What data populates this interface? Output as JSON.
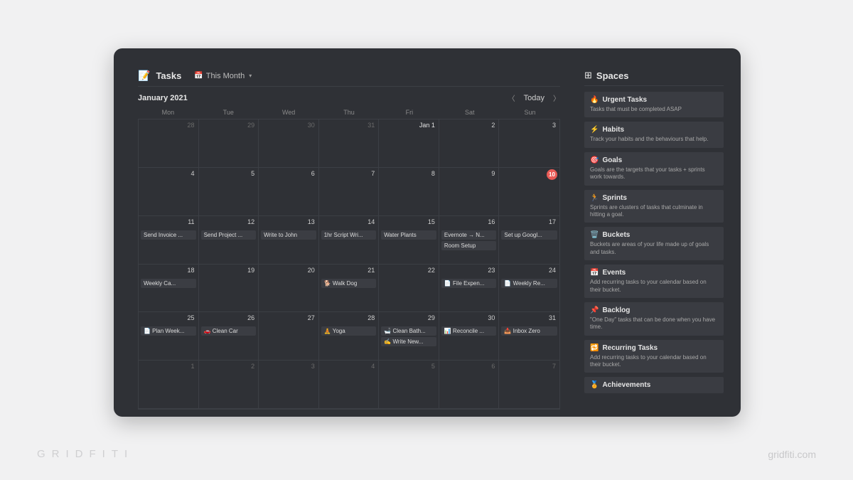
{
  "watermark": {
    "left": "GRIDFITI",
    "right": "gridfiti.com"
  },
  "header": {
    "tasks_icon": "📝",
    "tasks_title": "Tasks",
    "view_icon": "📅",
    "view_label": "This Month"
  },
  "month": {
    "title": "January 2021",
    "today_label": "Today",
    "weekdays": [
      "Mon",
      "Tue",
      "Wed",
      "Thu",
      "Fri",
      "Sat",
      "Sun"
    ]
  },
  "spaces_header": {
    "icon": "⊞",
    "title": "Spaces"
  },
  "spaces": [
    {
      "emoji": "🔥",
      "name": "Urgent Tasks",
      "desc": "Tasks that must be completed ASAP"
    },
    {
      "emoji": "⚡",
      "name": "Habits",
      "desc": "Track your habits and the behaviours that help."
    },
    {
      "emoji": "🎯",
      "name": "Goals",
      "desc": "Goals are the targets that your tasks + sprints work towards."
    },
    {
      "emoji": "🏃",
      "name": "Sprints",
      "desc": "Sprints are clusters of tasks that culminate in hitting a goal."
    },
    {
      "emoji": "🗑️",
      "name": "Buckets",
      "desc": "Buckets are areas of your life made up of goals and tasks."
    },
    {
      "emoji": "📅",
      "name": "Events",
      "desc": "Add recurring tasks to your calendar based on their bucket."
    },
    {
      "emoji": "📌",
      "name": "Backlog",
      "desc": "\"One Day\" tasks that can be done when you have time."
    },
    {
      "emoji": "🔁",
      "name": "Recurring Tasks",
      "desc": "Add recurring tasks to your calendar based on their bucket."
    },
    {
      "emoji": "🏅",
      "name": "Achievements",
      "desc": ""
    }
  ],
  "cells": [
    {
      "date": "28",
      "out": true,
      "events": []
    },
    {
      "date": "29",
      "out": true,
      "events": []
    },
    {
      "date": "30",
      "out": true,
      "events": []
    },
    {
      "date": "31",
      "out": true,
      "events": []
    },
    {
      "date": "Jan 1",
      "special": true,
      "events": []
    },
    {
      "date": "2",
      "events": []
    },
    {
      "date": "3",
      "events": []
    },
    {
      "date": "4",
      "events": []
    },
    {
      "date": "5",
      "events": []
    },
    {
      "date": "6",
      "events": []
    },
    {
      "date": "7",
      "events": []
    },
    {
      "date": "8",
      "events": []
    },
    {
      "date": "9",
      "events": []
    },
    {
      "date": "10",
      "today": true,
      "events": []
    },
    {
      "date": "11",
      "events": [
        "Send Invoice ..."
      ]
    },
    {
      "date": "12",
      "events": [
        "Send Project ..."
      ]
    },
    {
      "date": "13",
      "events": [
        "Write to John"
      ]
    },
    {
      "date": "14",
      "events": [
        "1hr Script Wri..."
      ]
    },
    {
      "date": "15",
      "events": [
        "Water Plants"
      ]
    },
    {
      "date": "16",
      "events": [
        "Evernote → N...",
        "Room Setup"
      ]
    },
    {
      "date": "17",
      "events": [
        "Set up Googl..."
      ]
    },
    {
      "date": "18",
      "events": [
        "Weekly Ca..."
      ]
    },
    {
      "date": "19",
      "events": []
    },
    {
      "date": "20",
      "events": []
    },
    {
      "date": "21",
      "events": [
        "🐕 Walk Dog"
      ]
    },
    {
      "date": "22",
      "events": []
    },
    {
      "date": "23",
      "events": [
        "📄 File Expen..."
      ]
    },
    {
      "date": "24",
      "events": [
        "📄 Weekly Re..."
      ]
    },
    {
      "date": "25",
      "events": [
        "📄 Plan Week..."
      ]
    },
    {
      "date": "26",
      "events": [
        "🚗 Clean Car"
      ]
    },
    {
      "date": "27",
      "events": []
    },
    {
      "date": "28",
      "events": [
        "🧘 Yoga"
      ]
    },
    {
      "date": "29",
      "events": [
        "🛁 Clean Bath...",
        "✍️ Write New..."
      ]
    },
    {
      "date": "30",
      "events": [
        "📊 Reconcile ..."
      ]
    },
    {
      "date": "31",
      "events": [
        "📥 Inbox Zero"
      ]
    },
    {
      "date": "1",
      "out": true,
      "events": []
    },
    {
      "date": "2",
      "out": true,
      "events": []
    },
    {
      "date": "3",
      "out": true,
      "events": []
    },
    {
      "date": "4",
      "out": true,
      "events": []
    },
    {
      "date": "5",
      "out": true,
      "events": []
    },
    {
      "date": "6",
      "out": true,
      "events": []
    },
    {
      "date": "7",
      "out": true,
      "events": []
    }
  ]
}
